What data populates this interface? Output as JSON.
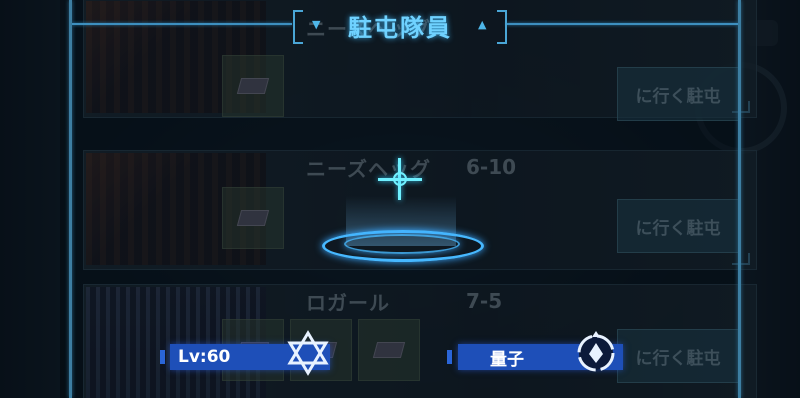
{
  "header": {
    "title": "駐屯隊員"
  },
  "cards": [
    {
      "name": "ニーズヘッグ",
      "stage": "6-10",
      "go_label": "に行く駐屯"
    },
    {
      "name": "ロガール",
      "stage": "7-5",
      "go_label": "に行く駐屯"
    },
    {
      "name": "",
      "stage": "",
      "go_label": "に行く駐屯"
    }
  ],
  "member": {
    "level": "Lv:60",
    "type": "量子"
  },
  "icons": {
    "rank": "hexagram-icon",
    "element": "quantum-icon",
    "target": "crosshair-icon"
  },
  "colors": {
    "accent": "#6fd2ff",
    "badge": "#1e4fb8"
  }
}
